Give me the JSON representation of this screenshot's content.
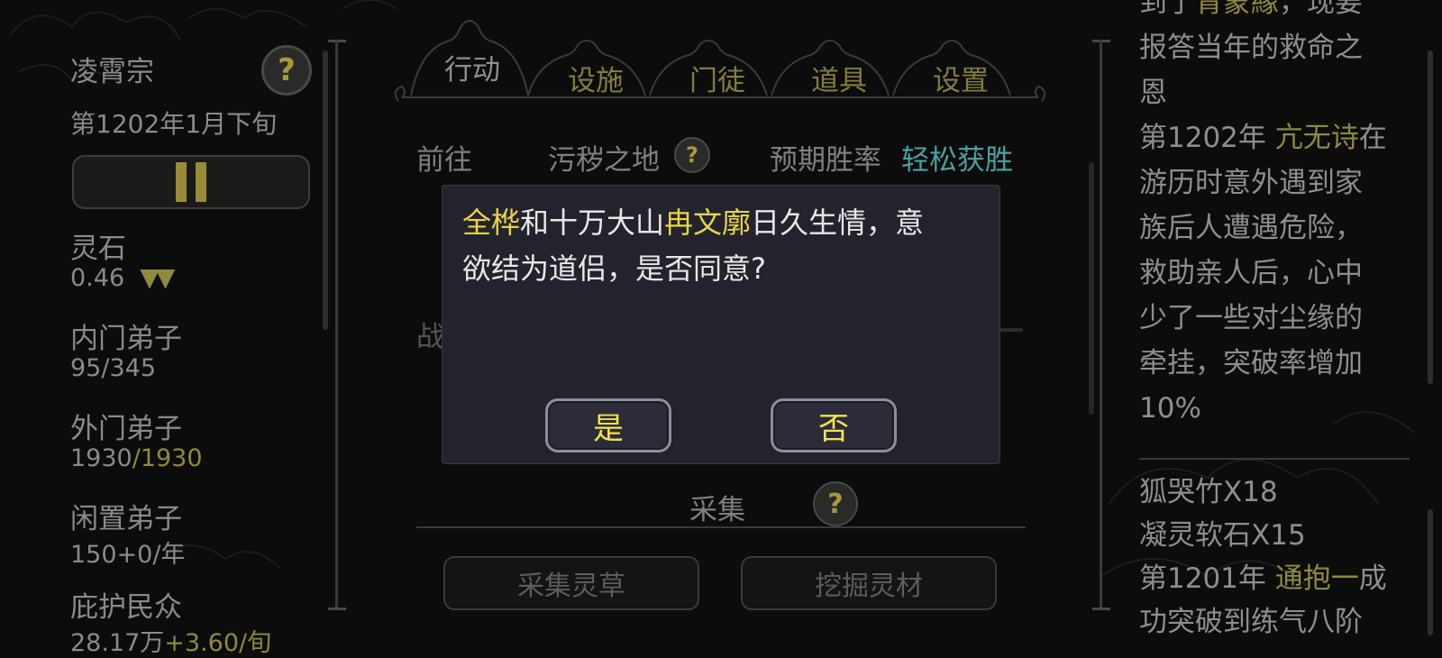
{
  "sect": {
    "name": "凌霄宗",
    "date": "第1202年1月下旬",
    "stats": [
      {
        "label": "灵石",
        "value_main": "0.46",
        "value_extra": "",
        "arrows": "▼▼"
      },
      {
        "label": "内门弟子",
        "value_main": "95",
        "value_extra": "/345",
        "arrows": ""
      },
      {
        "label": "外门弟子",
        "value_main": "1930",
        "value_extra": "/1930",
        "arrows": ""
      },
      {
        "label": "闲置弟子",
        "value_main": "150",
        "value_extra": "+0/年",
        "arrows": ""
      },
      {
        "label": "庇护民众",
        "value_main": "28.17万",
        "value_extra": "+3.60/旬",
        "arrows": ""
      }
    ]
  },
  "help_icon_glyph": "?",
  "tabs": [
    {
      "label": "行动",
      "active": true
    },
    {
      "label": "设施",
      "active": false
    },
    {
      "label": "门徒",
      "active": false
    },
    {
      "label": "道具",
      "active": false
    },
    {
      "label": "设置",
      "active": false
    }
  ],
  "action": {
    "go_label": "前往",
    "destination": "污秽之地",
    "win_rate_label": "预期胜率",
    "win_rate_value": "轻松获胜",
    "battle_label": "战斗中",
    "gather_title": "采集",
    "gather_herbs": "采集灵草",
    "dig_materials": "挖掘灵材"
  },
  "dialog": {
    "name1": "全桦",
    "text1": "和十万大山",
    "name2": "冉文廓",
    "text2": "日久生情，意",
    "line2": "欲结为道侣，是否同意?",
    "yes": "是",
    "no": "否"
  },
  "log": {
    "l0a": "到了",
    "l0b": "青蒙緣",
    "l0c": "，现要",
    "l1": "报答当年的救命之",
    "l2": "恩",
    "l3a": "第1202年 ",
    "l3b": "亢无诗",
    "l3c": "在",
    "l4": "游历时意外遇到家",
    "l5": "族后人遭遇危险，",
    "l6": "救助亲人后，心中",
    "l7": "少了一些对尘缘的",
    "l8": "牵挂，突破率增加",
    "l9": "10%",
    "l10": "狐哭竹X18",
    "l11": "凝灵软石X15",
    "l12a": "第1201年 ",
    "l12b": "通抱一",
    "l12c": "成",
    "l13": "功突破到练气八阶"
  },
  "colors": {
    "accent_gold": "#e8d44a",
    "olive": "#8f8a3c",
    "teal": "#4aa0a0",
    "dialog_bg": "#23232e"
  }
}
